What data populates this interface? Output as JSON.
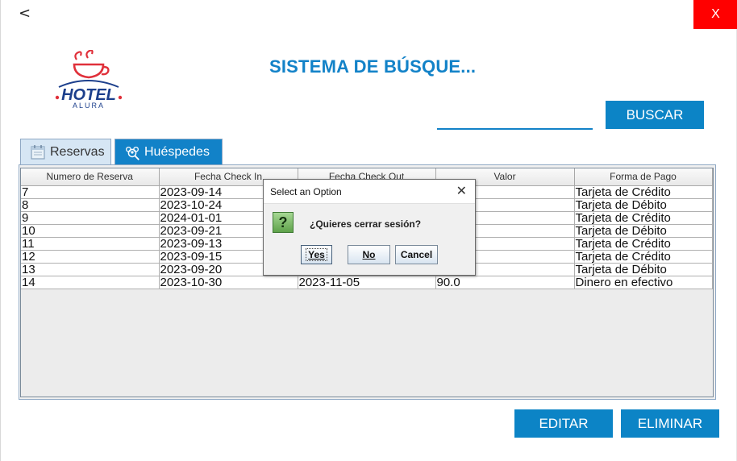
{
  "window": {
    "back_label": "<",
    "close_label": "X"
  },
  "header": {
    "title": "SISTEMA DE BÚSQUE...",
    "logo_text": "HOTEL",
    "logo_subtext": "ALURA"
  },
  "search": {
    "value": "",
    "button_label": "BUSCAR"
  },
  "tabs": [
    {
      "label": "Reservas",
      "icon": "calendar-icon"
    },
    {
      "label": "Huéspedes",
      "icon": "guests-icon"
    }
  ],
  "table": {
    "columns": [
      "Numero de Reserva",
      "Fecha Check In",
      "Fecha Check Out",
      "Valor",
      "Forma de Pago"
    ],
    "rows": [
      [
        "7",
        "2023-09-14",
        "",
        "",
        "Tarjeta de Crédito"
      ],
      [
        "8",
        "2023-10-24",
        "",
        "",
        "Tarjeta de Débito"
      ],
      [
        "9",
        "2024-01-01",
        "",
        "",
        "Tarjeta de Crédito"
      ],
      [
        "10",
        "2023-09-21",
        "",
        "",
        "Tarjeta de Débito"
      ],
      [
        "11",
        "2023-09-13",
        "",
        "",
        "Tarjeta de Crédito"
      ],
      [
        "12",
        "2023-09-15",
        "",
        "",
        "Tarjeta de Crédito"
      ],
      [
        "13",
        "2023-09-20",
        "",
        "",
        "Tarjeta de Débito"
      ],
      [
        "14",
        "2023-10-30",
        "2023-11-05",
        "90.0",
        "Dinero en efectivo"
      ]
    ]
  },
  "actions": {
    "edit_label": "EDITAR",
    "delete_label": "ELIMINAR"
  },
  "dialog": {
    "title": "Select an Option",
    "close_label": "X",
    "icon_label": "?",
    "message": "¿Quieres cerrar sesión?",
    "yes_label": "Yes",
    "no_label": "No",
    "cancel_label": "Cancel"
  },
  "colors": {
    "accent": "#1282c8",
    "button": "#0c84c6",
    "close": "#ff0000"
  }
}
